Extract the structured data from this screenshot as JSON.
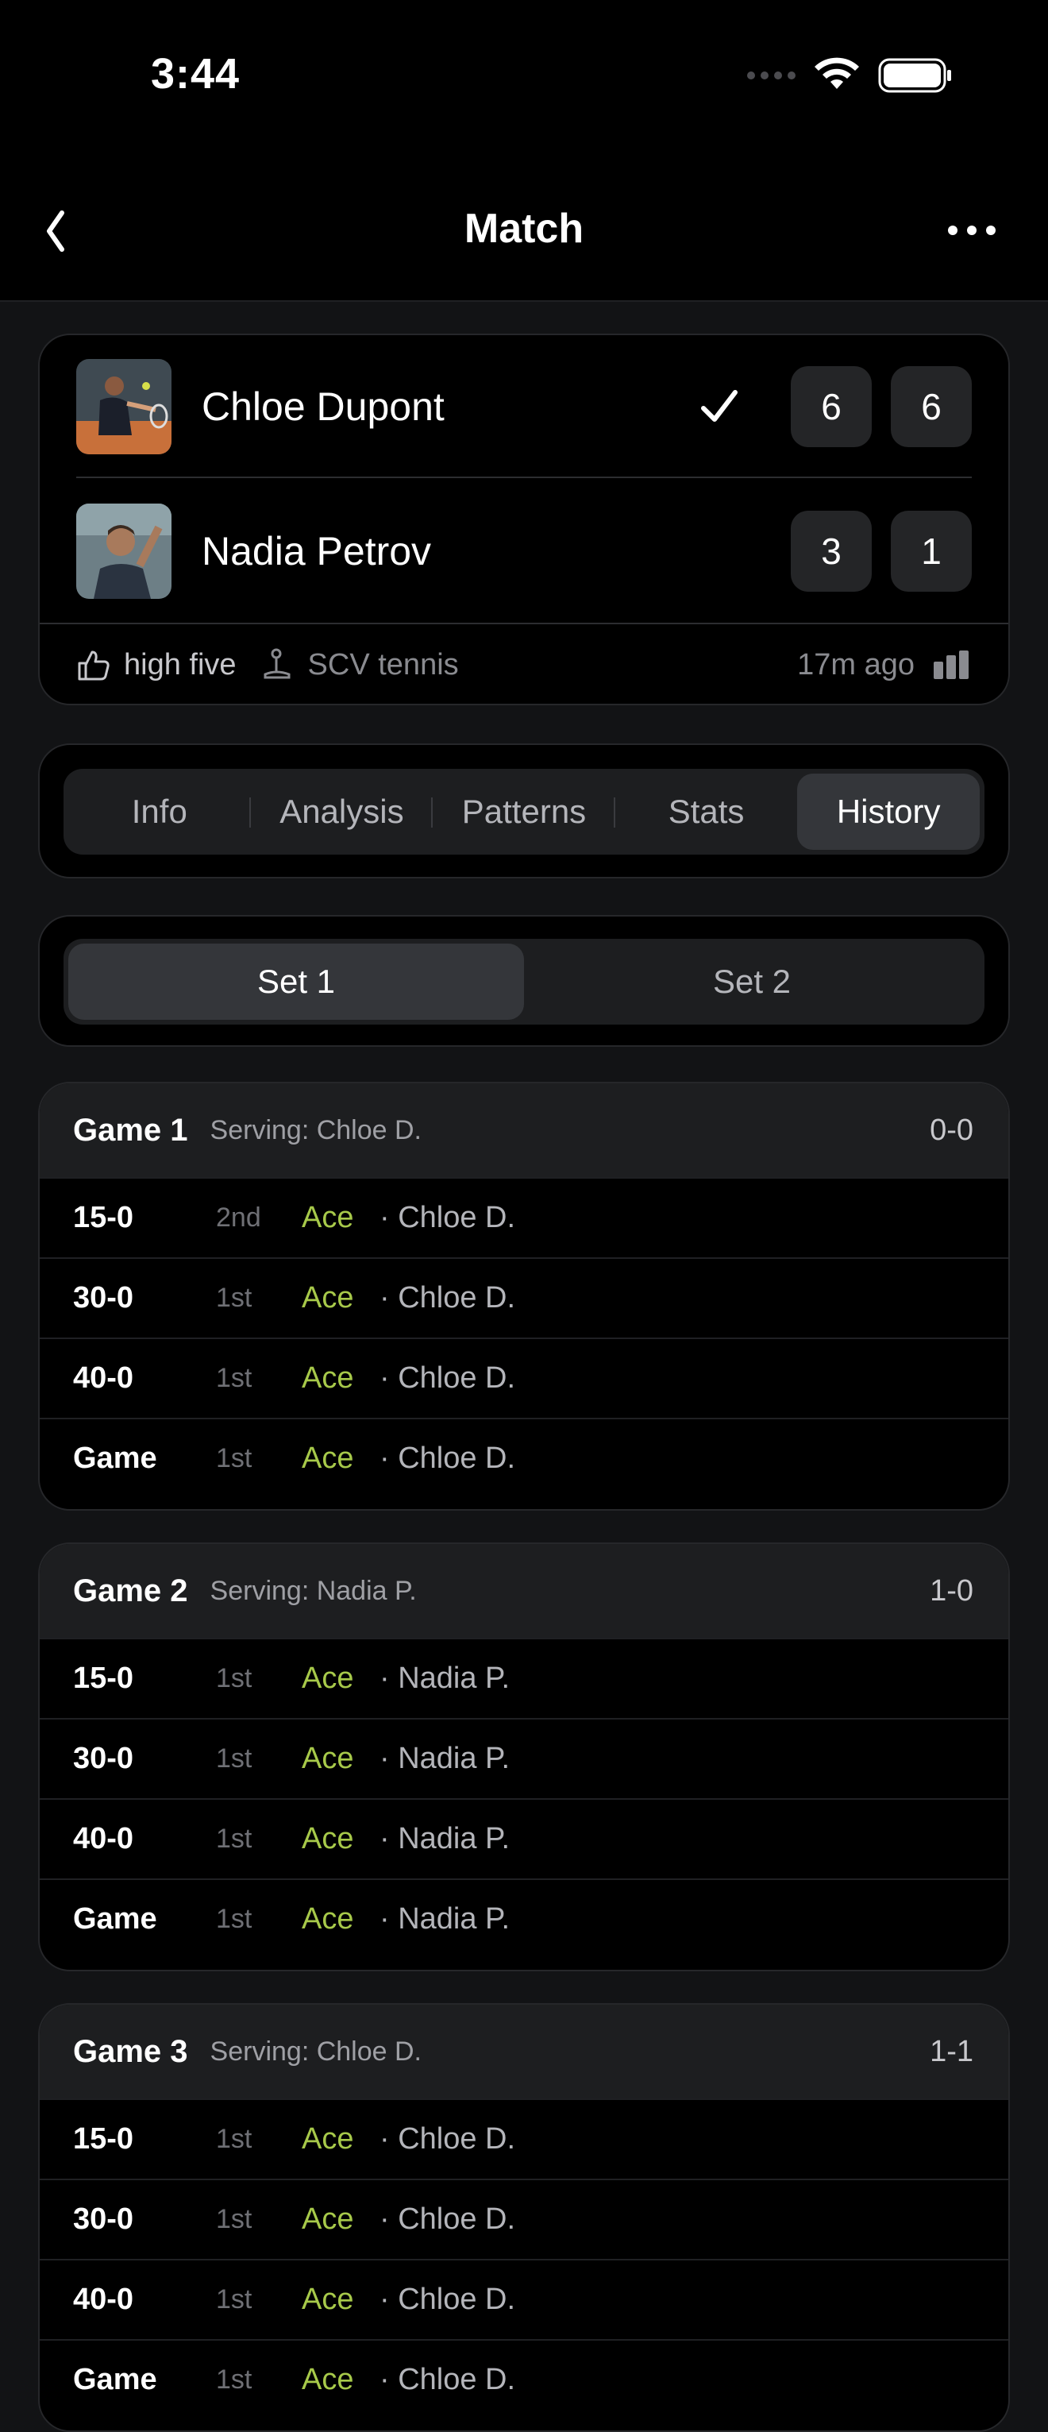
{
  "status_bar": {
    "time": "3:44"
  },
  "nav": {
    "title": "Match"
  },
  "match": {
    "players": [
      {
        "name": "Chloe Dupont",
        "winner": true,
        "sets": [
          "6",
          "6"
        ]
      },
      {
        "name": "Nadia Petrov",
        "winner": false,
        "sets": [
          "3",
          "1"
        ]
      }
    ],
    "high_five_label": "high five",
    "club": "SCV tennis",
    "time_ago": "17m ago"
  },
  "tabs": [
    {
      "label": "Info"
    },
    {
      "label": "Analysis"
    },
    {
      "label": "Patterns"
    },
    {
      "label": "Stats"
    },
    {
      "label": "History",
      "active": true
    }
  ],
  "sets": [
    {
      "label": "Set 1",
      "active": true
    },
    {
      "label": "Set 2"
    }
  ],
  "games": [
    {
      "title": "Game 1",
      "serving": "Serving: Chloe D.",
      "score": "0-0",
      "points": [
        {
          "score": "15-0",
          "serve": "2nd",
          "type": "Ace",
          "player": "· Chloe D."
        },
        {
          "score": "30-0",
          "serve": "1st",
          "type": "Ace",
          "player": "· Chloe D."
        },
        {
          "score": "40-0",
          "serve": "1st",
          "type": "Ace",
          "player": "· Chloe D."
        },
        {
          "score": "Game",
          "serve": "1st",
          "type": "Ace",
          "player": "· Chloe D."
        }
      ]
    },
    {
      "title": "Game 2",
      "serving": "Serving: Nadia P.",
      "score": "1-0",
      "points": [
        {
          "score": "15-0",
          "serve": "1st",
          "type": "Ace",
          "player": "· Nadia P."
        },
        {
          "score": "30-0",
          "serve": "1st",
          "type": "Ace",
          "player": "· Nadia P."
        },
        {
          "score": "40-0",
          "serve": "1st",
          "type": "Ace",
          "player": "· Nadia P."
        },
        {
          "score": "Game",
          "serve": "1st",
          "type": "Ace",
          "player": "· Nadia P."
        }
      ]
    },
    {
      "title": "Game 3",
      "serving": "Serving: Chloe D.",
      "score": "1-1",
      "points": [
        {
          "score": "15-0",
          "serve": "1st",
          "type": "Ace",
          "player": "· Chloe D."
        },
        {
          "score": "30-0",
          "serve": "1st",
          "type": "Ace",
          "player": "· Chloe D."
        },
        {
          "score": "40-0",
          "serve": "1st",
          "type": "Ace",
          "player": "· Chloe D."
        },
        {
          "score": "Game",
          "serve": "1st",
          "type": "Ace",
          "player": "· Chloe D."
        }
      ]
    }
  ],
  "colors": {
    "accent_green": "#a7c94a",
    "background": "#121315",
    "card": "#000000"
  },
  "icons": [
    "chevron-left-icon",
    "more-icon",
    "wifi-icon",
    "battery-icon",
    "checkmark-icon",
    "thumbs-up-icon",
    "joystick-icon",
    "signal-bars-icon"
  ]
}
